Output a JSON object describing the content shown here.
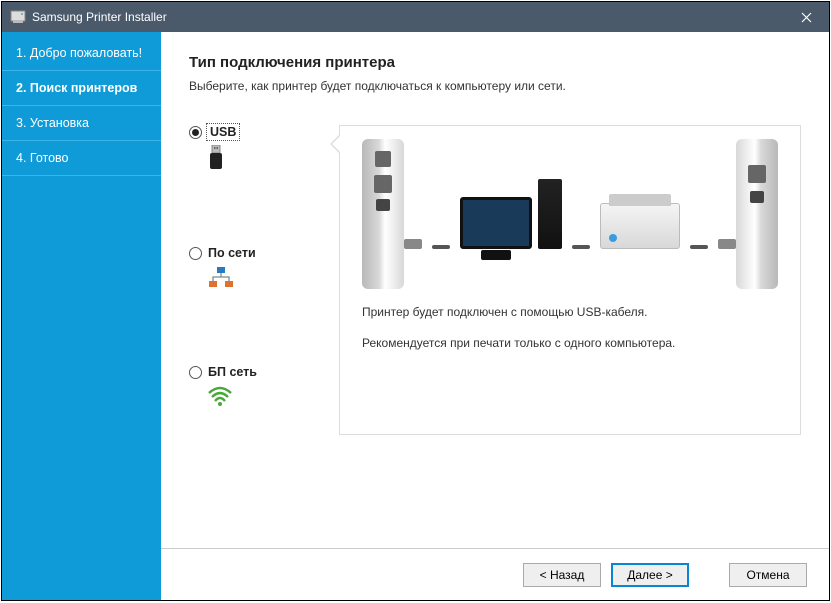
{
  "window": {
    "title": "Samsung Printer Installer"
  },
  "sidebar": {
    "items": [
      {
        "label": "1. Добро пожаловать!"
      },
      {
        "label": "2. Поиск принтеров"
      },
      {
        "label": "3. Установка"
      },
      {
        "label": "4. Готово"
      }
    ],
    "activeIndex": 1
  },
  "main": {
    "heading": "Тип подключения принтера",
    "subtitle": "Выберите, как принтер будет подключаться к компьютеру или сети.",
    "options": [
      {
        "label": "USB",
        "checked": true,
        "icon": "usb-connector-icon"
      },
      {
        "label": "По сети",
        "checked": false,
        "icon": "network-lan-icon"
      },
      {
        "label": "БП сеть",
        "checked": false,
        "icon": "wifi-icon"
      }
    ],
    "description": {
      "line1": "Принтер будет подключен с помощью USB-кабеля.",
      "line2": "Рекомендуется при печати только с одного компьютера."
    }
  },
  "footer": {
    "back": "< Назад",
    "next": "Далее >",
    "cancel": "Отмена"
  }
}
